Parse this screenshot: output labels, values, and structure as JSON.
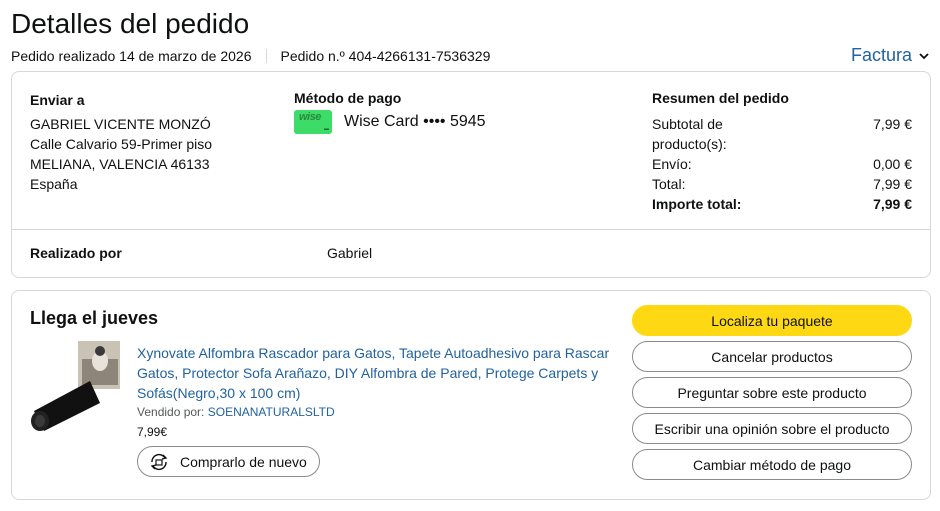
{
  "header": {
    "title": "Detalles del pedido",
    "order_date": "Pedido realizado 14 de marzo de 2026",
    "order_number": "Pedido n.º 404-4266131-7536329",
    "invoice_label": "Factura"
  },
  "shipping": {
    "label": "Enviar a",
    "lines": [
      "GABRIEL VICENTE MONZÓ",
      "Calle Calvario 59-Primer piso",
      "MELIANA, VALENCIA 46133",
      "España"
    ]
  },
  "payment": {
    "label": "Método de pago",
    "card_brand": "wise",
    "card_text": "Wise Card •••• 5945"
  },
  "summary": {
    "label": "Resumen del pedido",
    "rows": [
      {
        "k": "Subtotal de producto(s):",
        "v": "7,99 €"
      },
      {
        "k": "Envío:",
        "v": "0,00 €"
      },
      {
        "k": "Total:",
        "v": "7,99 €"
      },
      {
        "k": "Importe total:",
        "v": "7,99 €"
      }
    ]
  },
  "made_by": {
    "label": "Realizado por",
    "value": "Gabriel"
  },
  "shipment": {
    "arrival": "Llega el jueves",
    "product_title": "Xynovate Alfombra Rascador para Gatos, Tapete Autoadhesivo para Rascar Gatos, Protector Sofa Arañazo, DIY Alfombra de Pared, Protege Carpets y Sofás(Negro,30 x 100 cm)",
    "sold_by_label": "Vendido por:",
    "seller": "SOENANATURALSLTD",
    "price": "7,99€",
    "buy_again_label": "Comprarlo de nuevo"
  },
  "actions": [
    "Localiza tu paquete",
    "Cancelar productos",
    "Preguntar sobre este producto",
    "Escribir una opinión sobre el producto",
    "Cambiar método de pago"
  ],
  "colors": {
    "primary_button": "#ffd814",
    "link": "#2162a1",
    "card_green": "#3ddb67"
  }
}
